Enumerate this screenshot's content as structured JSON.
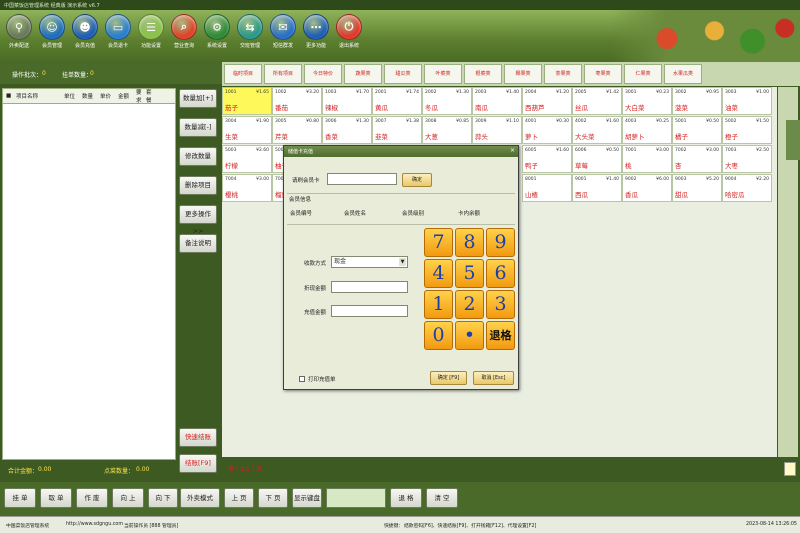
{
  "app": {
    "title": "中国菜饭店管理系统 经典版 演示系统 v6.7"
  },
  "toolbar": [
    {
      "label": "外卖配送",
      "icon": "delivery-icon",
      "color": "#6a7a5a",
      "glyph": "⚲"
    },
    {
      "label": "会员管理",
      "icon": "member-icon",
      "color": "#1f6fbf",
      "glyph": "☺"
    },
    {
      "label": "会员充值",
      "icon": "member-topup-icon",
      "color": "#1f5fb5",
      "glyph": "☻"
    },
    {
      "label": "会员退卡",
      "icon": "member-card-icon",
      "color": "#2a7fd0",
      "glyph": "▭"
    },
    {
      "label": "功能设置",
      "icon": "settings-icon",
      "color": "#8bc34a",
      "glyph": "☰"
    },
    {
      "label": "营业查询",
      "icon": "search-icon",
      "color": "#e0432a",
      "glyph": "⌕"
    },
    {
      "label": "系统设置",
      "icon": "gear-icon",
      "color": "#2f8b3a",
      "glyph": "⚙"
    },
    {
      "label": "交班管理",
      "icon": "shift-icon",
      "color": "#2b9a8a",
      "glyph": "⇆"
    },
    {
      "label": "短信群发",
      "icon": "sms-icon",
      "color": "#2a6fc9",
      "glyph": "✉"
    },
    {
      "label": "更多功能",
      "icon": "more-icon",
      "color": "#1f5fb5",
      "glyph": "⋯"
    },
    {
      "label": "退出系统",
      "icon": "power-icon",
      "color": "#e03a2e",
      "glyph": "⏻"
    }
  ],
  "order": {
    "batch_label": "操作批次：",
    "batch_value": "0",
    "hang_label": "挂单数量：",
    "hang_value": "0",
    "columns": [
      "项目名称",
      "单位",
      "数量",
      "单价",
      "金额",
      "要求",
      "套餐"
    ],
    "total_label": "合计金额：",
    "total_value": "0.00",
    "count_label": "点菜数量：",
    "count_value": "0.00"
  },
  "side_buttons": [
    {
      "label": "数量加[+]",
      "red": false
    },
    {
      "label": "数量减[-]",
      "red": false
    },
    {
      "label": "修改数量",
      "red": false
    },
    {
      "label": "删除项目",
      "red": false
    },
    {
      "label": "更多操作>>",
      "red": false
    },
    {
      "label": "备注说明",
      "red": false
    },
    {
      "label": "快速结账",
      "red": true
    },
    {
      "label": "结账[F9]",
      "red": true
    }
  ],
  "categories": [
    "临时项目",
    "所有项目",
    "今日特价",
    "蔬果类",
    "甜瓜类",
    "叶菜类",
    "根菜类",
    "椰果类",
    "茶果类",
    "枣果类",
    "仁果类",
    "水果瓜类"
  ],
  "dishes": [
    [
      {
        "code": "1001",
        "price": "¥1.65",
        "name": "茄子"
      },
      {
        "code": "1002",
        "price": "¥3.20",
        "name": "番茄"
      },
      {
        "code": "1003",
        "price": "¥1.70",
        "name": "辣椒"
      },
      {
        "code": "2001",
        "price": "¥1.74",
        "name": "黄瓜"
      },
      {
        "code": "2002",
        "price": "¥1.30",
        "name": "冬瓜"
      },
      {
        "code": "2003",
        "price": "¥1.40",
        "name": "南瓜"
      },
      {
        "code": "2004",
        "price": "¥1.20",
        "name": "西葫芦"
      },
      {
        "code": "2005",
        "price": "¥1.42",
        "name": "丝瓜"
      },
      {
        "code": "3001",
        "price": "¥0.23",
        "name": "大白菜"
      },
      {
        "code": "3002",
        "price": "¥0.95",
        "name": "菠菜"
      },
      {
        "code": "3003",
        "price": "¥1.00",
        "name": "油菜"
      }
    ],
    [
      {
        "code": "3004",
        "price": "¥1.90",
        "name": "生菜"
      },
      {
        "code": "3005",
        "price": "¥0.80",
        "name": "芹菜"
      },
      {
        "code": "3006",
        "price": "¥1.30",
        "name": "香菜"
      },
      {
        "code": "3007",
        "price": "¥1.38",
        "name": "韭菜"
      },
      {
        "code": "3008",
        "price": "¥0.85",
        "name": "大葱"
      },
      {
        "code": "3009",
        "price": "¥1.10",
        "name": "蒜头"
      },
      {
        "code": "4001",
        "price": "¥0.30",
        "name": "萝卜"
      },
      {
        "code": "4002",
        "price": "¥1.60",
        "name": "大头菜"
      },
      {
        "code": "4003",
        "price": "¥0.25",
        "name": "胡萝卜"
      },
      {
        "code": "5001",
        "price": "¥0.50",
        "name": "橘子"
      },
      {
        "code": "5002",
        "price": "¥1.50",
        "name": "橙子"
      }
    ],
    [
      {
        "code": "5003",
        "price": "¥2.60",
        "name": "柠檬"
      },
      {
        "code": "5004",
        "price": "¥1.10",
        "name": "柚子"
      },
      {
        "code": "",
        "price": "",
        "name": ""
      },
      {
        "code": "",
        "price": "",
        "name": ""
      },
      {
        "code": "",
        "price": "",
        "name": ""
      },
      {
        "code": "",
        "price": "",
        "name": ""
      },
      {
        "code": "6005",
        "price": "¥1.60",
        "name": "鸭子"
      },
      {
        "code": "6006",
        "price": "¥0.50",
        "name": "草莓"
      },
      {
        "code": "7001",
        "price": "¥3.00",
        "name": "桃"
      },
      {
        "code": "7002",
        "price": "¥3.00",
        "name": "杏"
      },
      {
        "code": "7003",
        "price": "¥2.50",
        "name": "大枣"
      }
    ],
    [
      {
        "code": "7004",
        "price": "¥3.00",
        "name": "樱桃"
      },
      {
        "code": "7005",
        "price": "",
        "name": "榴莲"
      },
      {
        "code": "",
        "price": "",
        "name": ""
      },
      {
        "code": "",
        "price": "",
        "name": ""
      },
      {
        "code": "",
        "price": "",
        "name": ""
      },
      {
        "code": "",
        "price": "",
        "name": ""
      },
      {
        "code": "8001",
        "price": "",
        "name": "山楂"
      },
      {
        "code": "9001",
        "price": "¥1.40",
        "name": "西瓜"
      },
      {
        "code": "9002",
        "price": "¥6.00",
        "name": "香瓜"
      },
      {
        "code": "9003",
        "price": "¥5.20",
        "name": "甜瓜"
      },
      {
        "code": "9004",
        "price": "¥2.20",
        "name": "哈密瓜"
      }
    ]
  ],
  "pager": "第 ( 1/1 ) 页",
  "bottom_buttons": [
    "挂 单",
    "取 单",
    "作 废",
    "向 上",
    "向 下",
    "外卖模式",
    "上 页",
    "下 页",
    "显示键盘",
    "退 格",
    "清 空"
  ],
  "status": {
    "company": "中国菜饭店管理系统",
    "url": "http://www.sdgngu.com",
    "operator": "当前操作员 [888 管理员]",
    "shortcuts_label": "快捷键：",
    "shortcuts": "结款密码[F6]、快速结账[F9]、打开钱箱[F12]、代理设置[F2]",
    "datetime": "2023-08-14 13:26:05"
  },
  "dialog": {
    "title": "储值卡充值",
    "card_label": "请刷会员卡",
    "confirm_label": "确定",
    "member_info_title": "会员信息",
    "member_cols": [
      "会员编号",
      "会员姓名",
      "会员级别",
      "卡内余额"
    ],
    "pay_method_label": "收款方式",
    "pay_method_value": "现金",
    "discount_label": "折现金额",
    "topup_label": "充值金额",
    "print_label": "打印充值单",
    "ok_button": "确定 [F9]",
    "cancel_button": "取消 [Esc]",
    "keys": [
      "7",
      "8",
      "9",
      "4",
      "5",
      "6",
      "1",
      "2",
      "3",
      "0",
      "•",
      "退格"
    ]
  }
}
